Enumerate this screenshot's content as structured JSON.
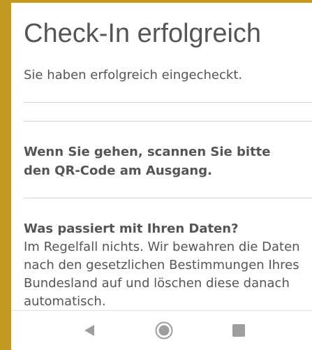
{
  "page": {
    "title": "Check-In erfolgreich",
    "subtitle": "Sie haben erfolgreich eingecheckt.",
    "notice": "Wenn Sie gehen, scannen Sie bitte den QR-Code am Ausgang.",
    "data_section": {
      "heading": "Was passiert mit Ihren Daten?",
      "body": "Im Regelfall nichts. Wir bewahren die Daten nach den gesetzlichen Bestimmungen Ihres Bundesland auf und löschen diese danach automatisch."
    }
  },
  "navigation_bar": {
    "buttons": [
      {
        "name": "back",
        "icon": "triangle-back-icon"
      },
      {
        "name": "home",
        "icon": "circle-home-icon"
      },
      {
        "name": "recents",
        "icon": "square-recents-icon"
      }
    ]
  },
  "colors": {
    "frame": "#c39a22",
    "text": "#555555",
    "divider": "#d4d4d4",
    "nav_icon": "#9e9e9e"
  }
}
